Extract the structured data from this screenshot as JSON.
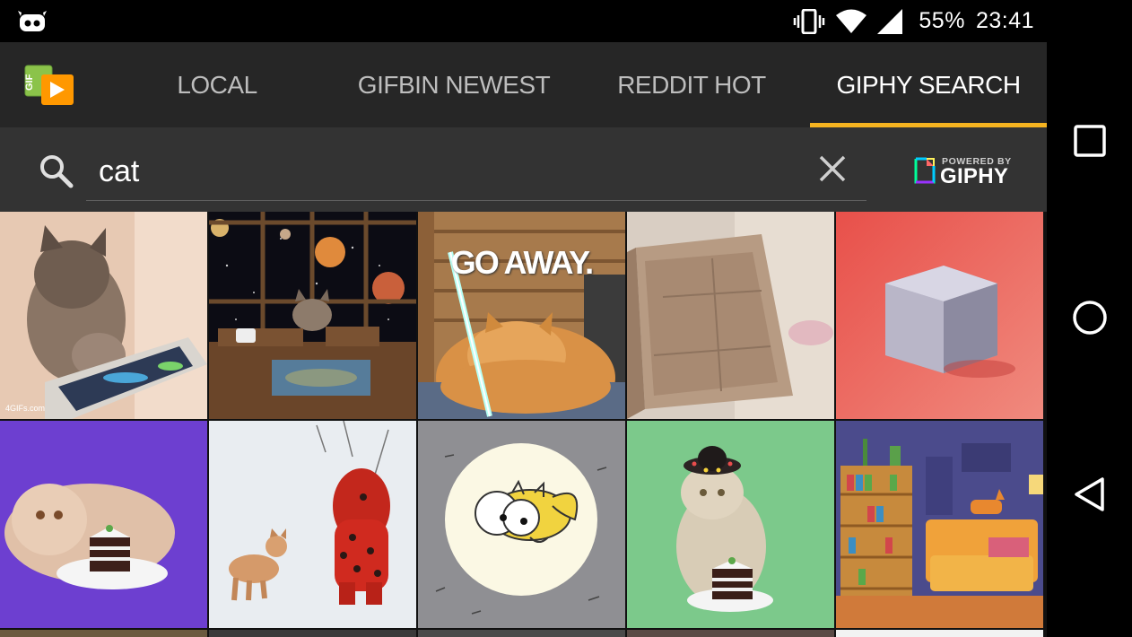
{
  "status_bar": {
    "battery": "55%",
    "time": "23:41",
    "icons": [
      "android-notification-icon",
      "vibrate-icon",
      "wifi-icon",
      "cell-signal-icon"
    ]
  },
  "tabs": [
    {
      "label": "LOCAL",
      "active": false
    },
    {
      "label": "GIFBIN NEWEST",
      "active": false
    },
    {
      "label": "REDDIT HOT",
      "active": false
    },
    {
      "label": "GIPHY SEARCH",
      "active": true
    }
  ],
  "search": {
    "value": "cat",
    "powered_by_small": "POWERED BY",
    "powered_by_brand": "GIPHY"
  },
  "gifs": [
    {
      "name": "kitten-playing-tablet",
      "caption": "4GIFs.com"
    },
    {
      "name": "cat-space-window"
    },
    {
      "name": "cat-lightsaber",
      "caption": "GO AWAY."
    },
    {
      "name": "cardboard-box"
    },
    {
      "name": "glitter-cube"
    },
    {
      "name": "persian-cat-cake-purple"
    },
    {
      "name": "child-and-kitten-snow"
    },
    {
      "name": "cartoon-cat-moon"
    },
    {
      "name": "persian-cat-sombrero-cake"
    },
    {
      "name": "pixel-room-cat"
    }
  ],
  "colors": {
    "accent": "#f5b320",
    "tab_bar": "#262626",
    "search_bar": "#333333",
    "status_bar": "#000000"
  },
  "nav_bar": [
    "recents-button",
    "home-button",
    "back-button"
  ]
}
